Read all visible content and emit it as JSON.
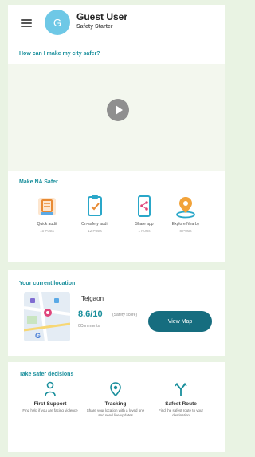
{
  "header": {
    "user_name": "Guest User",
    "user_role": "Safety Starter",
    "avatar_letter": "G"
  },
  "video": {
    "title": "How can I make my city safer?"
  },
  "make_safer": {
    "title": "Make NA Safer",
    "items": [
      {
        "label": "Quick audit",
        "count": "10 Posts",
        "icon": "audit-icon"
      },
      {
        "label": "On-safety audit",
        "count": "12 Posts",
        "icon": "clipboard-icon"
      },
      {
        "label": "Share app",
        "count": "1 Posts",
        "icon": "share-phone-icon"
      },
      {
        "label": "Explore Nearby",
        "count": "8 Posts",
        "icon": "location-icon"
      }
    ]
  },
  "location": {
    "title": "Your current location",
    "place": "Tejgaon",
    "score": "8.6/10",
    "score_note": "(Safety score)",
    "comments": "0Comments",
    "button": "View Map"
  },
  "decisions": {
    "title": "Take safer decisions",
    "items": [
      {
        "title": "First Support",
        "desc": "Find help if you are facing violence",
        "icon": "support-icon"
      },
      {
        "title": "Tracking",
        "desc": "Share your location with a loved one and send live updates",
        "icon": "tracking-icon"
      },
      {
        "title": "Safest Route",
        "desc": "Find the safest route to your destination",
        "icon": "route-icon"
      }
    ]
  },
  "colors": {
    "accent": "#1a8f9c",
    "button": "#166d7f",
    "background": "#e9f3e3"
  }
}
